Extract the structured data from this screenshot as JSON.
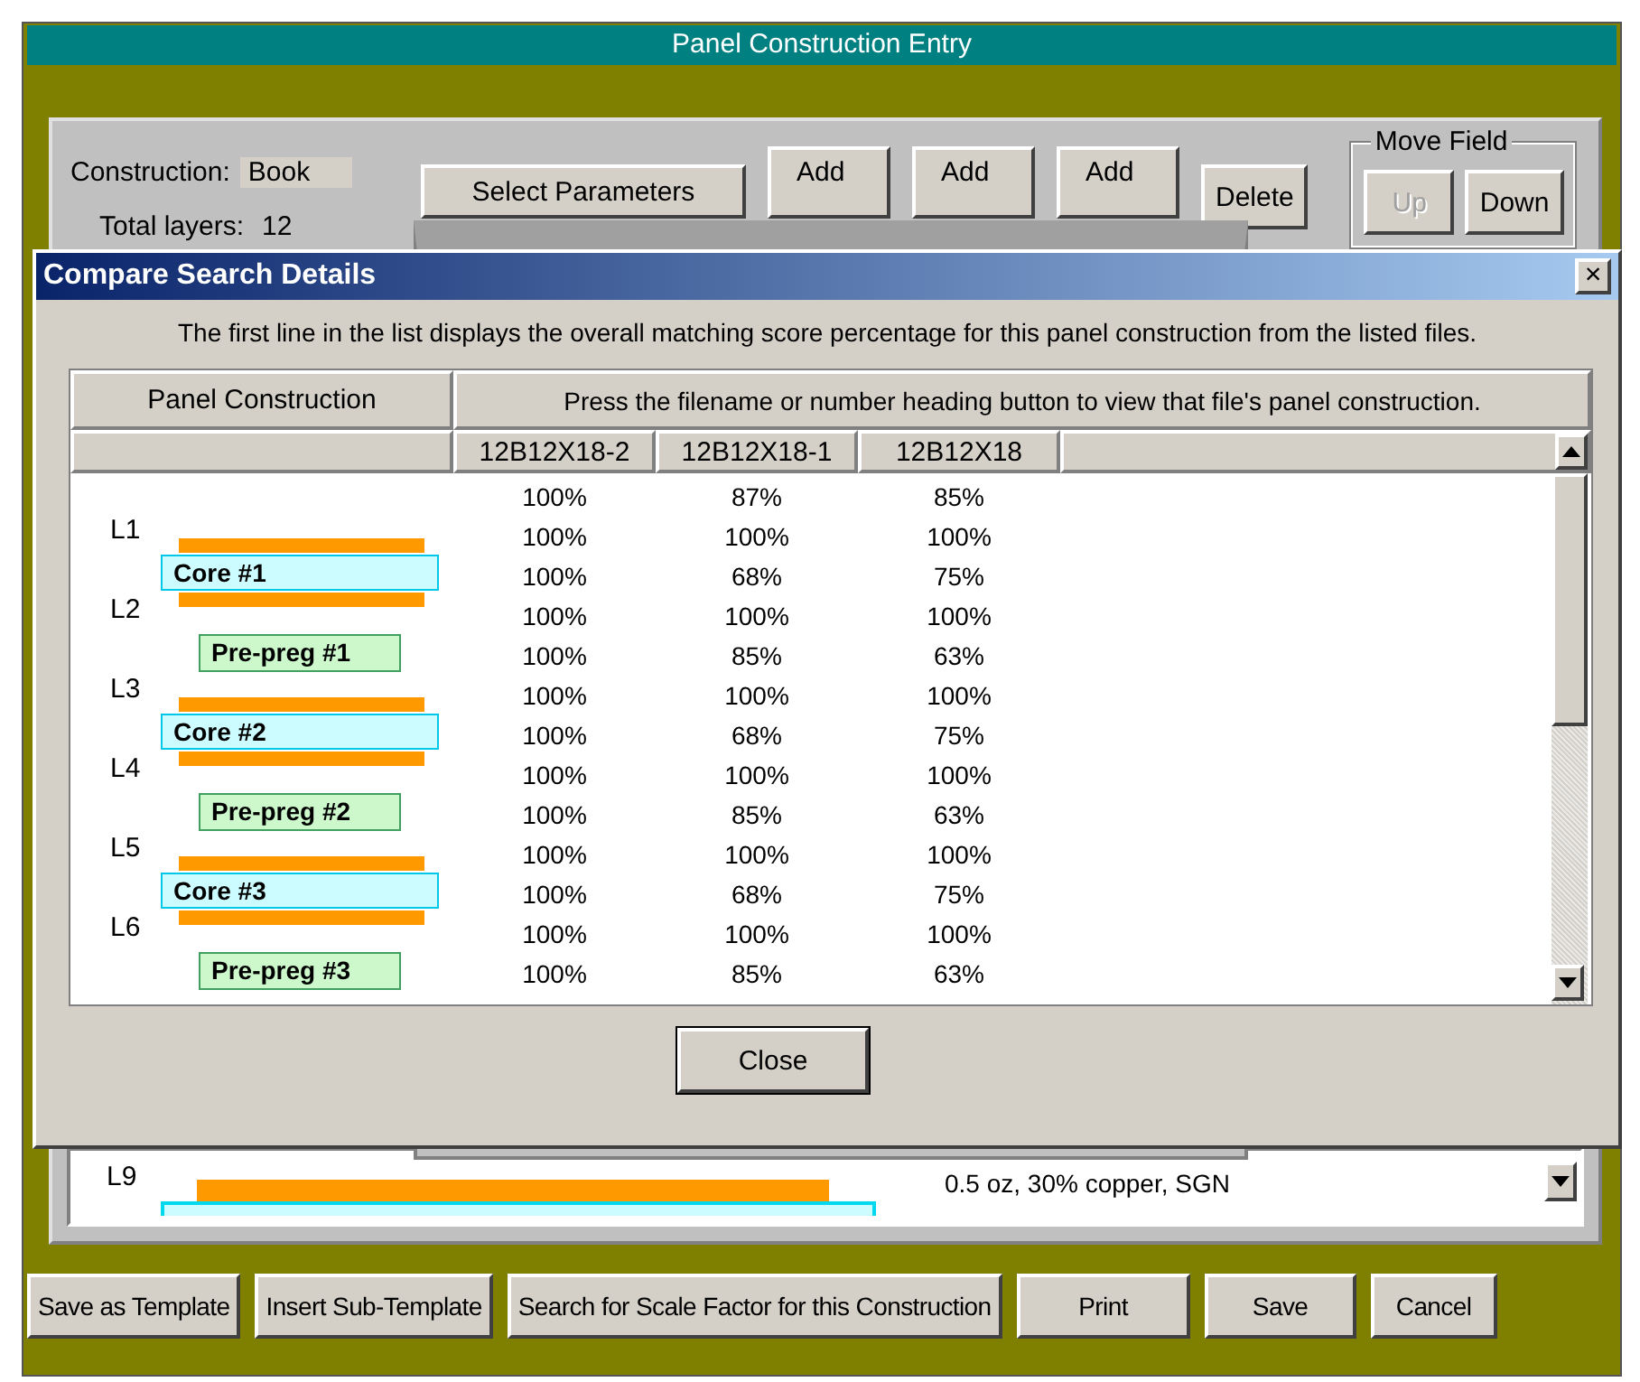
{
  "window": {
    "title": "Panel Construction Entry"
  },
  "construction": {
    "label": "Construction:",
    "value": "Book"
  },
  "total_layers": {
    "label": "Total layers:",
    "value": "12"
  },
  "toolbar": [
    {
      "label": "Select Parameters",
      "kind": "wide"
    },
    {
      "label": "Add",
      "kind": "tall"
    },
    {
      "label": "Add",
      "kind": "tall"
    },
    {
      "label": "Add",
      "kind": "tall"
    },
    {
      "label": "Delete",
      "kind": "wide"
    }
  ],
  "move_field": {
    "title": "Move Field",
    "buttons": [
      {
        "label": "Up",
        "disabled": true
      },
      {
        "label": "Down",
        "disabled": false
      }
    ]
  },
  "background_list": {
    "layer": "L9",
    "detail": "0.5 oz, 30% copper, SGN"
  },
  "dialog": {
    "title": "Compare Search Details",
    "close_glyph": "×",
    "instruction": "The first line in the list displays the overall matching score percentage for this panel construction from the listed files.",
    "header": {
      "left": "Panel Construction",
      "right": "Press the filename or number heading button to view that file's panel construction."
    },
    "files": [
      "12B12X18-2",
      "12B12X18-1",
      "12B12X18"
    ],
    "stackup": [
      {
        "kind": "layer",
        "label": "L1"
      },
      {
        "kind": "core",
        "label": "Core #1"
      },
      {
        "kind": "layer",
        "label": "L2"
      },
      {
        "kind": "prepreg",
        "label": "Pre-preg #1"
      },
      {
        "kind": "layer",
        "label": "L3"
      },
      {
        "kind": "core",
        "label": "Core #2"
      },
      {
        "kind": "layer",
        "label": "L4"
      },
      {
        "kind": "prepreg",
        "label": "Pre-preg #2"
      },
      {
        "kind": "layer",
        "label": "L5"
      },
      {
        "kind": "core",
        "label": "Core #3"
      },
      {
        "kind": "layer",
        "label": "L6"
      },
      {
        "kind": "prepreg",
        "label": "Pre-preg #3"
      }
    ],
    "rows": [
      [
        "100%",
        "87%",
        "85%"
      ],
      [
        "100%",
        "100%",
        "100%"
      ],
      [
        "100%",
        "68%",
        "75%"
      ],
      [
        "100%",
        "100%",
        "100%"
      ],
      [
        "100%",
        "85%",
        "63%"
      ],
      [
        "100%",
        "100%",
        "100%"
      ],
      [
        "100%",
        "68%",
        "75%"
      ],
      [
        "100%",
        "100%",
        "100%"
      ],
      [
        "100%",
        "85%",
        "63%"
      ],
      [
        "100%",
        "100%",
        "100%"
      ],
      [
        "100%",
        "68%",
        "75%"
      ],
      [
        "100%",
        "100%",
        "100%"
      ],
      [
        "100%",
        "85%",
        "63%"
      ]
    ],
    "close_button": "Close"
  },
  "footer_buttons": [
    "Save as Template",
    "Insert Sub-Template",
    "Search for Scale Factor for this Construction",
    "Print",
    "Save",
    "Cancel"
  ]
}
